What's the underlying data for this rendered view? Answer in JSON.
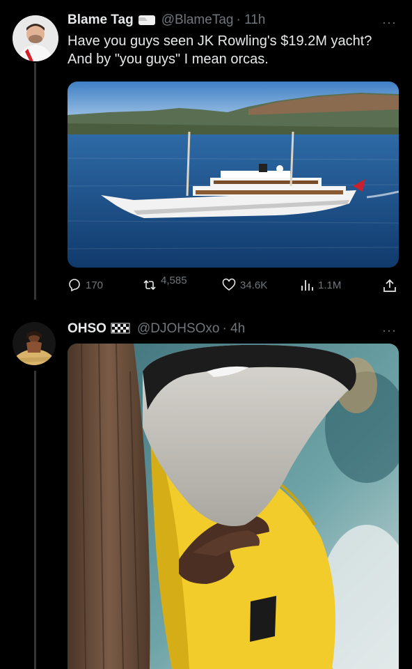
{
  "tweets": [
    {
      "name": "Blame Tag",
      "handle": "@BlameTag",
      "time": "· 11h",
      "text": "Have you guys seen JK Rowling's $19.2M yacht? And by \"you guys\" I mean orcas.",
      "actions": {
        "replies": "170",
        "retweets": "4,585",
        "likes": "34.6K",
        "views": "1.1M"
      }
    },
    {
      "name": "OHSO",
      "handle": "@DJOHSOxo",
      "time": "· 4h"
    }
  ],
  "icons": {
    "reply": "reply-icon",
    "retweet": "retweet-icon",
    "like": "heart-icon",
    "views": "views-icon",
    "share": "share-icon",
    "more": "more-icon",
    "badge": "business-badge-icon",
    "flag": "checkered-flag-icon"
  },
  "colors": {
    "background": "#000000",
    "text_primary": "#e7e9ea",
    "text_secondary": "#71767b",
    "jacket": "#f2cc2a"
  }
}
